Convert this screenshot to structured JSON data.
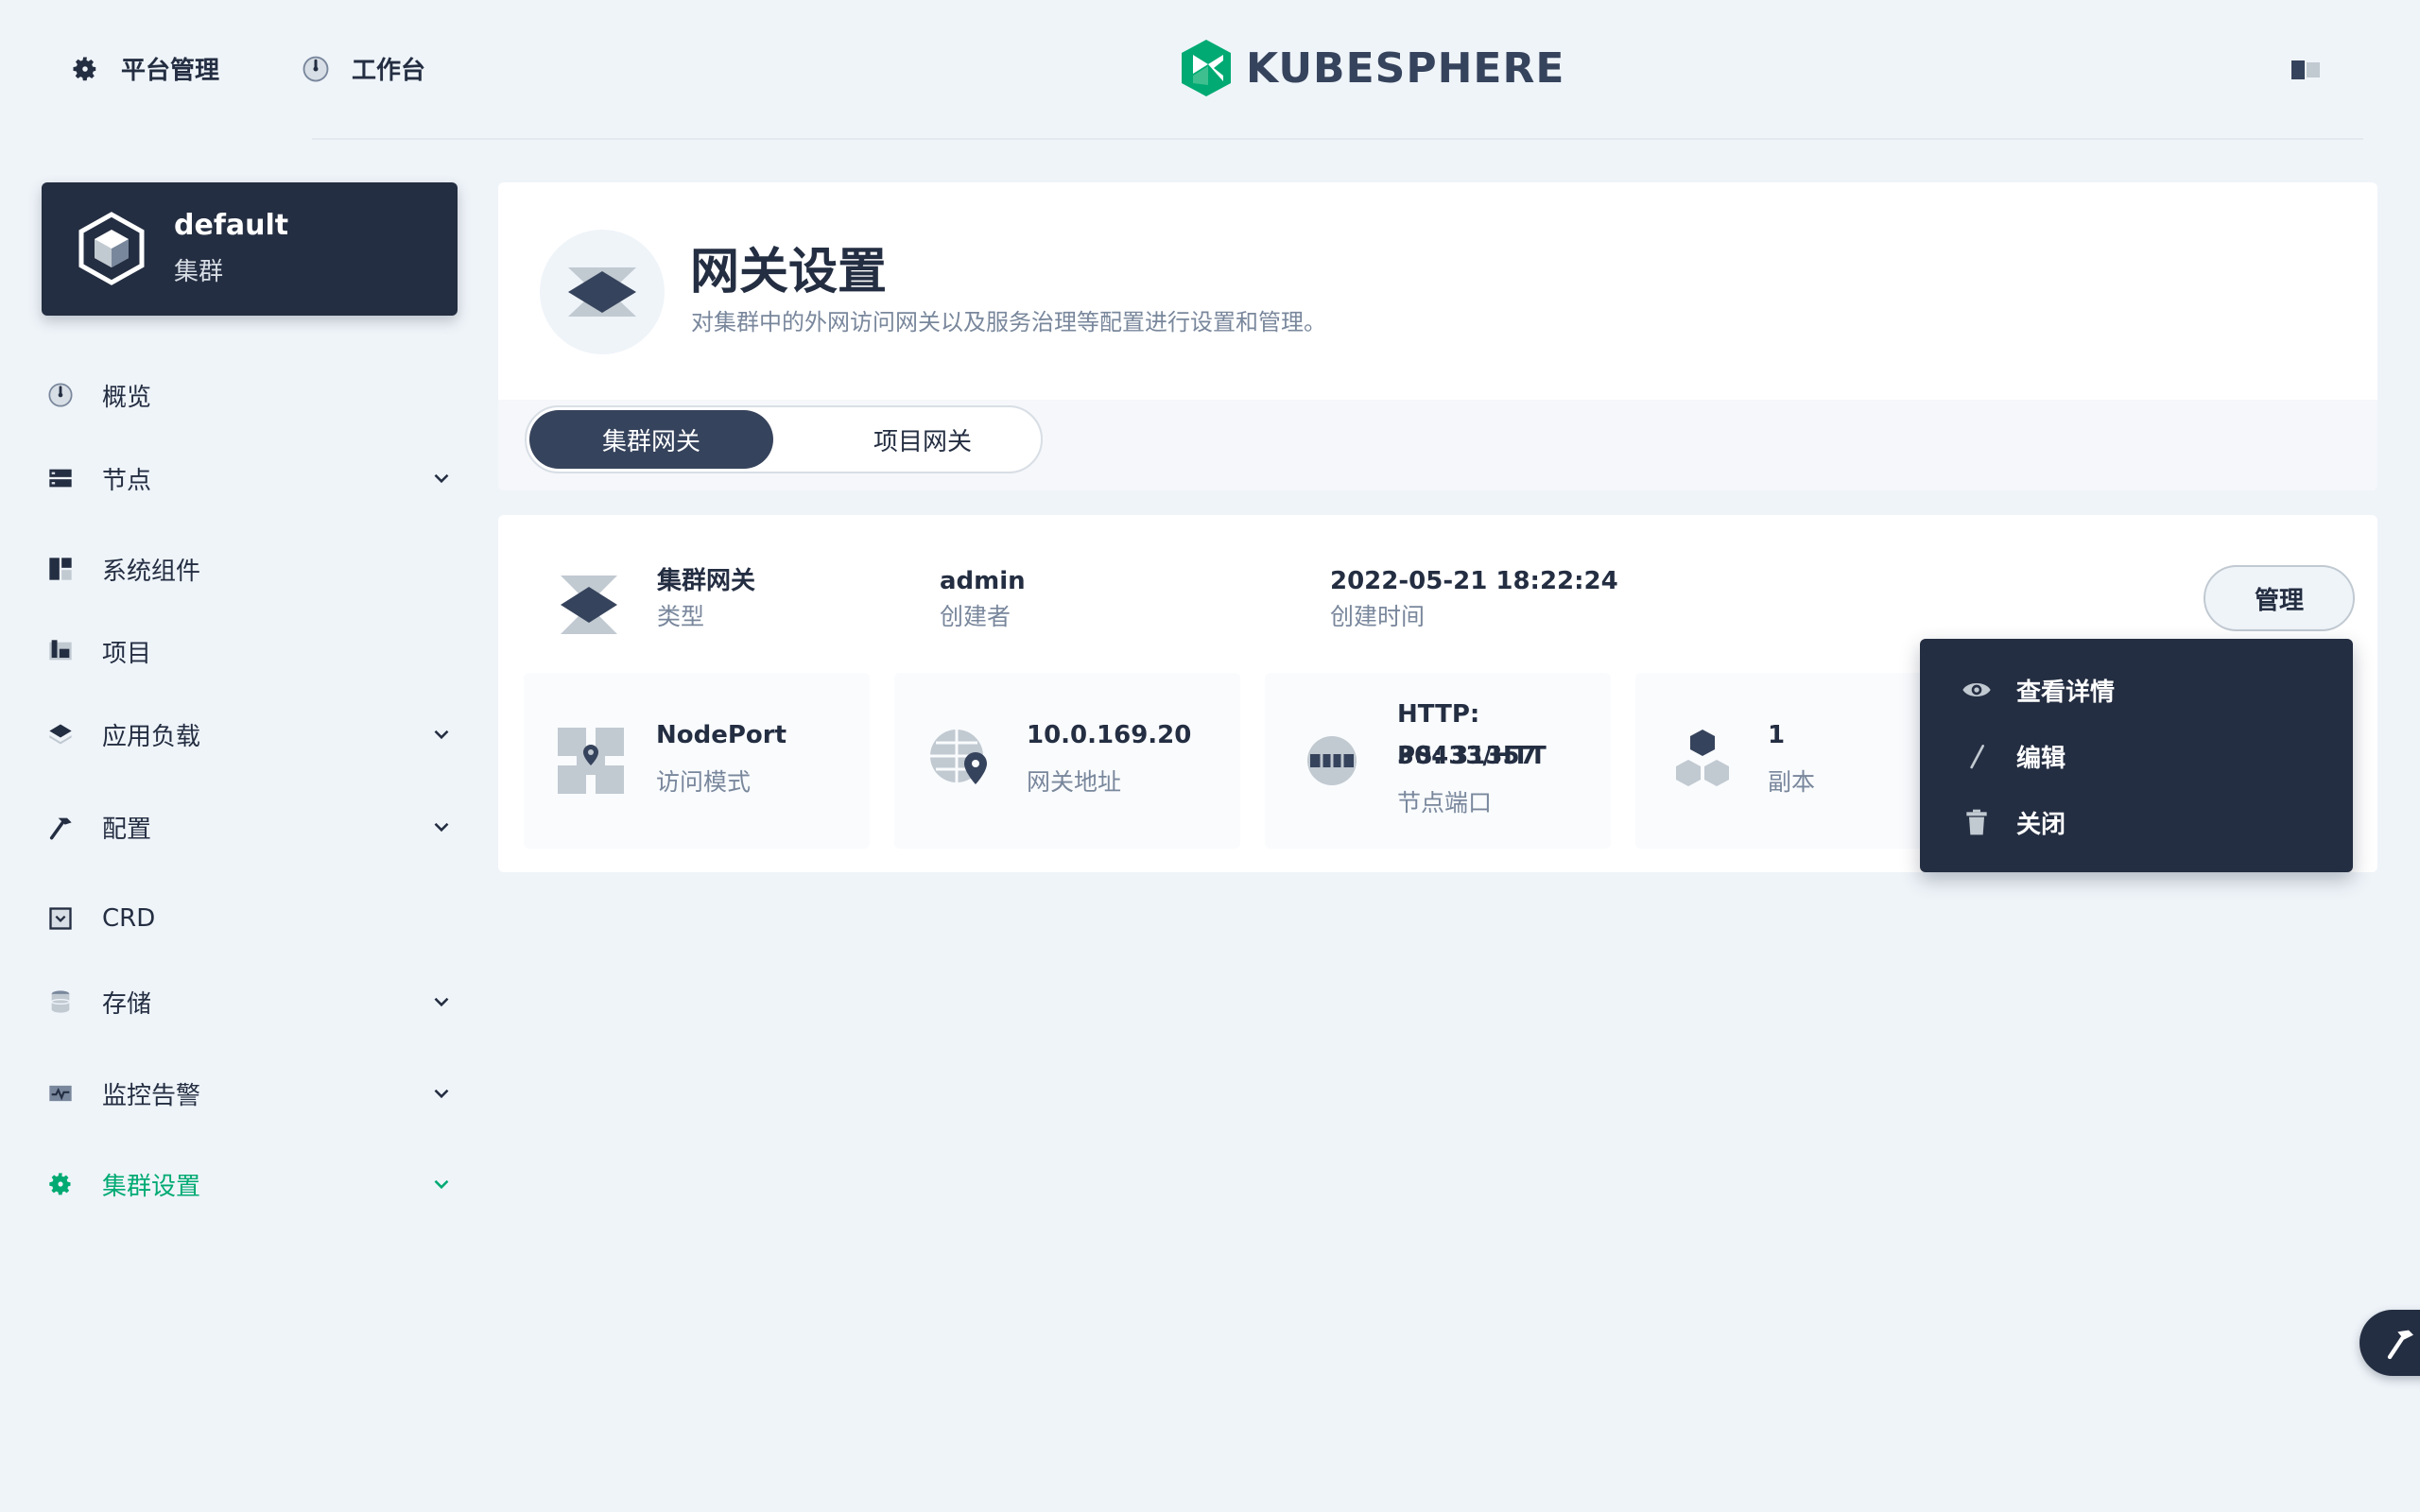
{
  "topbar": {
    "platform_label": "平台管理",
    "workbench_label": "工作台",
    "logo_text": "KUBESPHERE"
  },
  "sidebar": {
    "cluster": {
      "name": "default",
      "type": "集群"
    },
    "items": [
      {
        "label": "概览",
        "icon": "dashboard-icon",
        "expandable": false
      },
      {
        "label": "节点",
        "icon": "nodes-icon",
        "expandable": true
      },
      {
        "label": "系统组件",
        "icon": "components-icon",
        "expandable": false
      },
      {
        "label": "项目",
        "icon": "project-icon",
        "expandable": false
      },
      {
        "label": "应用负载",
        "icon": "appcenter-icon",
        "expandable": true
      },
      {
        "label": "配置",
        "icon": "hammer-icon",
        "expandable": true
      },
      {
        "label": "CRD",
        "icon": "crd-icon",
        "expandable": false
      },
      {
        "label": "存储",
        "icon": "database-icon",
        "expandable": true
      },
      {
        "label": "监控告警",
        "icon": "monitor-icon",
        "expandable": true
      },
      {
        "label": "集群设置",
        "icon": "gear-icon",
        "expandable": true,
        "active": true
      }
    ]
  },
  "header": {
    "title": "网关设置",
    "description": "对集群中的外网访问网关以及服务治理等配置进行设置和管理。",
    "tabs": [
      {
        "label": "集群网关",
        "selected": true
      },
      {
        "label": "项目网关",
        "selected": false
      }
    ]
  },
  "gateway": {
    "name": "集群网关",
    "name_key": "类型",
    "creator": "admin",
    "creator_key": "创建者",
    "created_time": "2022-05-21 18:22:24",
    "created_time_key": "创建时间",
    "manage_label": "管理",
    "stats": [
      {
        "value": "NodePort",
        "key": "访问模式",
        "icon": "nodeport-icon"
      },
      {
        "value": "10.0.169.20",
        "key": "网关地址",
        "icon": "gateway-address-icon"
      },
      {
        "value_line1": "HTTP: 30433/HTT",
        "value_line2": "PS: 31357",
        "key": "节点端口",
        "icon": "network-port-icon"
      },
      {
        "value": "1",
        "key": "副本",
        "icon": "replica-icon"
      }
    ]
  },
  "dropdown": {
    "items": [
      {
        "label": "查看详情",
        "icon": "eye-icon"
      },
      {
        "label": "编辑",
        "icon": "pen-icon"
      },
      {
        "label": "关闭",
        "icon": "trash-icon"
      }
    ]
  },
  "colors": {
    "accent": "#00aa72",
    "dark": "#242e42",
    "muted": "#79879c",
    "background": "#eff4f9"
  }
}
